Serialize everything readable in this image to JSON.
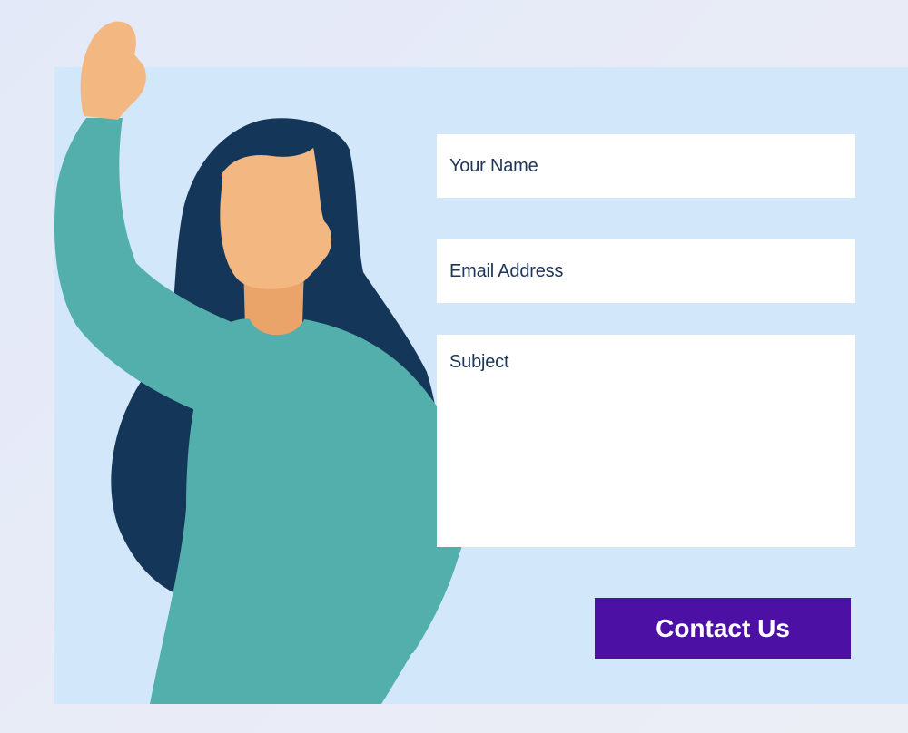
{
  "form": {
    "name_placeholder": "Your Name",
    "email_placeholder": "Email Address",
    "subject_placeholder": "Subject",
    "submit_label": "Contact Us"
  },
  "colors": {
    "page_background": "#e6ebf7",
    "panel_background": "#d3e7fb",
    "field_background": "#ffffff",
    "field_text": "#1d3657",
    "button_background": "#4c10a4",
    "button_text": "#ffffff",
    "hair": "#133659",
    "skin": "#f3b882",
    "neck_shadow": "#eaa369",
    "shirt": "#52afac"
  },
  "illustration": {
    "subject": "waving-woman-illustration"
  }
}
